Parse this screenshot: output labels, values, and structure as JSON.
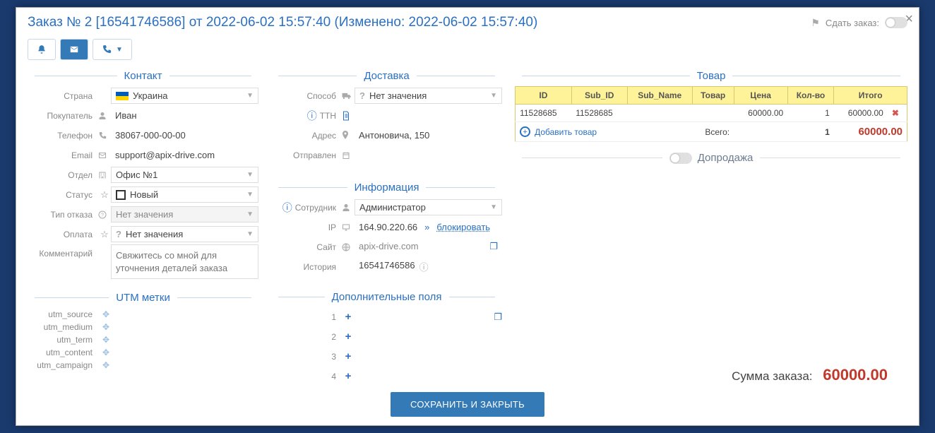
{
  "header": {
    "title": "Заказ № 2 [16541746586] от 2022-06-02 15:57:40 (Изменено: 2022-06-02 15:57:40)",
    "submit_label": "Сдать заказ:"
  },
  "sections": {
    "contact": "Контакт",
    "delivery": "Доставка",
    "product": "Товар",
    "info": "Информация",
    "additional": "Дополнительные поля",
    "utm": "UTM метки",
    "upsell": "Допродажа"
  },
  "contact": {
    "country_label": "Страна",
    "country_value": "Украина",
    "buyer_label": "Покупатель",
    "buyer_value": "Иван",
    "phone_label": "Телефон",
    "phone_value": "38067-000-00-00",
    "email_label": "Email",
    "email_value": "support@apix-drive.com",
    "dept_label": "Отдел",
    "dept_value": "Офис №1",
    "status_label": "Статус",
    "status_value": "Новый",
    "refuse_label": "Тип отказа",
    "refuse_value": "Нет значения",
    "payment_label": "Оплата",
    "payment_value": "Нет значения",
    "comment_label": "Комментарий",
    "comment_value": "Свяжитесь со мной для уточнения деталей заказа"
  },
  "delivery": {
    "method_label": "Способ",
    "method_value": "Нет значения",
    "ttn_label": "ТТН",
    "address_label": "Адрес",
    "address_value": "Антоновича, 150",
    "sent_label": "Отправлен"
  },
  "info": {
    "employee_label": "Сотрудник",
    "employee_value": "Администратор",
    "ip_label": "IP",
    "ip_value": "164.90.220.66",
    "ip_block": "блокировать",
    "site_label": "Сайт",
    "site_value": "apix-drive.com",
    "history_label": "История",
    "history_value": "16541746586"
  },
  "additional": {
    "row1": "1",
    "row2": "2",
    "row3": "3",
    "row4": "4"
  },
  "utm": {
    "source": "utm_source",
    "medium": "utm_medium",
    "term": "utm_term",
    "content": "utm_content",
    "campaign": "utm_campaign"
  },
  "product": {
    "headers": {
      "id": "ID",
      "sub_id": "Sub_ID",
      "sub_name": "Sub_Name",
      "name": "Товар",
      "price": "Цена",
      "qty": "Кол-во",
      "total": "Итого"
    },
    "row": {
      "id": "11528685",
      "sub_id": "11528685",
      "sub_name": "",
      "name": "",
      "price": "60000.00",
      "qty": "1",
      "total": "60000.00"
    },
    "add_label": "Добавить товар",
    "sum_label": "Всего:",
    "sum_qty": "1",
    "sum_total": "60000.00"
  },
  "order_sum": {
    "label": "Сумма заказа:",
    "value": "60000.00"
  },
  "footer": {
    "save": "СОХРАНИТЬ И ЗАКРЫТЬ"
  }
}
